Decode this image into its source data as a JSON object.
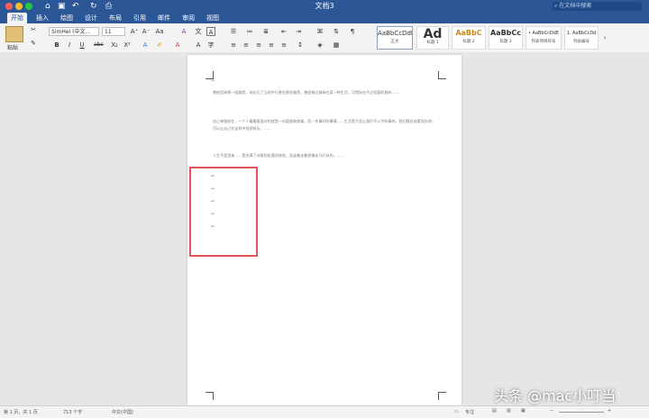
{
  "app": {
    "doc_title": "文档3",
    "search_placeholder": "在文档中搜索"
  },
  "quick_access": {
    "home_icon": "home-icon",
    "save_icon": "save-icon",
    "undo_icon": "undo-icon",
    "redo_icon": "redo-icon",
    "print_icon": "print-icon"
  },
  "tabs": [
    "开始",
    "插入",
    "绘图",
    "设计",
    "布局",
    "引用",
    "邮件",
    "审阅",
    "视图"
  ],
  "ribbon": {
    "paste_label": "粘贴",
    "font_name": "SimHei (中文...",
    "font_size": "11",
    "styles": [
      {
        "preview": "AaBbCcDdEe",
        "name": "正文"
      },
      {
        "preview": "Ad",
        "name": "标题 1"
      },
      {
        "preview": "AaBbC",
        "name": "标题 2"
      },
      {
        "preview": "AaBbCc",
        "name": "标题 3"
      },
      {
        "preview": "• AaBbCcDdE",
        "name": "列表项目符号"
      },
      {
        "preview": "1. AaBbCcDd",
        "name": "列表编号"
      }
    ]
  },
  "document": {
    "paragraphs": [
      "曾经回体那一段路程，却忘记了当时步行曾在那些路旁。曾经推过放纵在某一种生活，可惜存在不过短暂的放纵……",
      "自己单独前往，一个人最需要面对的就是一份孤独和寂寞，而一件事好的事情……生活是不会让我们不公平的事的，我们都应该看到光明，可以让自己在这其中找到快乐，……",
      "人生不是用来……是充满了诗意和失落的旅程，而走着走着就像走马灯似的，……"
    ]
  },
  "status": {
    "page_info": "第 1 页，共 1 页",
    "word_count": "713 个字",
    "language": "中文(中国)",
    "focus": "专注"
  },
  "watermark": "头条 @mac小叮当"
}
